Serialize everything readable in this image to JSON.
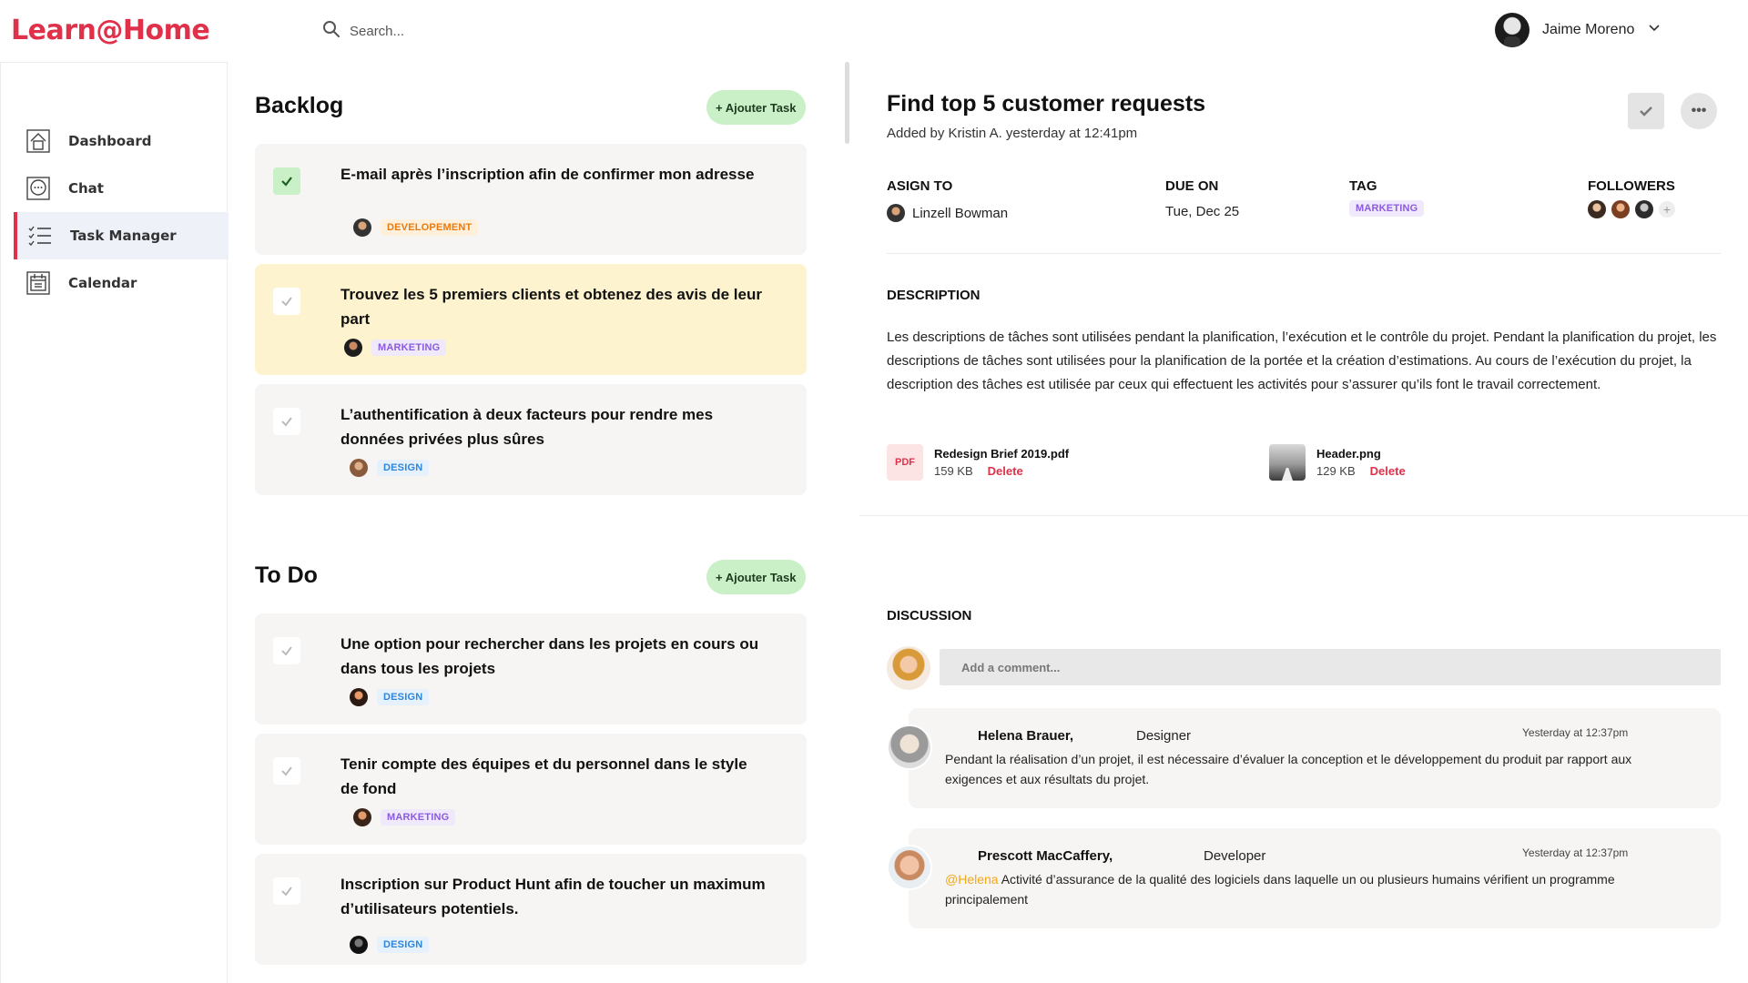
{
  "app": {
    "logo": "Learn@Home"
  },
  "search": {
    "placeholder": "Search..."
  },
  "user": {
    "name": "Jaime Moreno"
  },
  "sidebar": {
    "items": [
      {
        "label": "Dashboard",
        "icon": "home-icon"
      },
      {
        "label": "Chat",
        "icon": "chat-icon"
      },
      {
        "label": "Task Manager",
        "icon": "list-icon",
        "active": true
      },
      {
        "label": "Calendar",
        "icon": "calendar-icon"
      }
    ]
  },
  "backlog": {
    "title": "Backlog",
    "add_label": "+ Ajouter Task",
    "tasks": [
      {
        "title": "E-mail après l’inscription afin de confirmer mon adresse",
        "tag": "DEVELOPEMENT",
        "done": true
      },
      {
        "title": "Trouvez les 5 premiers clients et obtenez des avis de leur part",
        "tag": "MARKETING",
        "done": false
      },
      {
        "title": "L’authentification à deux facteurs pour rendre mes données privées plus sûres",
        "tag": "DESIGN",
        "done": false
      }
    ]
  },
  "todo": {
    "title": "To Do",
    "add_label": "+ Ajouter Task",
    "tasks": [
      {
        "title": "Une option pour rechercher dans les projets en cours ou dans tous les projets",
        "tag": "DESIGN",
        "done": false
      },
      {
        "title": "Tenir compte des équipes et du personnel dans le style de fond",
        "tag": "MARKETING",
        "done": false
      },
      {
        "title": "Inscription sur Product Hunt afin de toucher un maximum d’utilisateurs potentiels.",
        "tag": "DESIGN",
        "done": false
      }
    ]
  },
  "detail": {
    "title": "Find top 5 customer requests",
    "subtitle": "Added by Kristin A. yesterday at 12:41pm",
    "fields": {
      "assign_label": "ASIGN TO",
      "assign_value": "Linzell Bowman",
      "due_label": "DUE ON",
      "due_value": "Tue, Dec 25",
      "tag_label": "TAG",
      "tag_value": "MARKETING",
      "followers_label": "FOLLOWERS",
      "followers_add": "+"
    },
    "description_label": "DESCRIPTION",
    "description": "Les descriptions de tâches sont utilisées pendant la planification, l’exécution et le contrôle du projet. Pendant la planification du projet, les descriptions de tâches sont utilisées pour la planification de la portée et la création d’estimations. Au cours de l’exécution du projet, la description des tâches est utilisée par ceux qui effectuent les activités pour s’assurer qu’ils font le travail correctement.",
    "attachments": [
      {
        "icon_label": "PDF",
        "name": "Redesign Brief 2019.pdf",
        "size": "159 KB",
        "delete": "Delete"
      },
      {
        "name": "Header.png",
        "size": "129 KB",
        "delete": "Delete"
      }
    ],
    "more_glyph": "•••"
  },
  "discussion": {
    "label": "DISCUSSION",
    "input_placeholder": "Add a comment...",
    "comments": [
      {
        "name": "Helena Brauer,",
        "role": "Designer",
        "time": "Yesterday at 12:37pm",
        "mention": "",
        "text": "Pendant la réalisation d’un projet, il est nécessaire d’évaluer la conception et le développement du produit par rapport aux exigences et aux résultats du projet."
      },
      {
        "name": "Prescott MacCaffery,",
        "role": "Developer",
        "time": "Yesterday at 12:37pm",
        "mention": "@Helena",
        "text": " Activité d’assurance de la qualité des logiciels dans laquelle un ou plusieurs humains vérifient un programme principalement"
      }
    ]
  },
  "colors": {
    "brand": "#e0314b",
    "add_button": "#c9f0c7",
    "highlight_card": "#fdf3cf",
    "mention": "#f0a81c"
  }
}
